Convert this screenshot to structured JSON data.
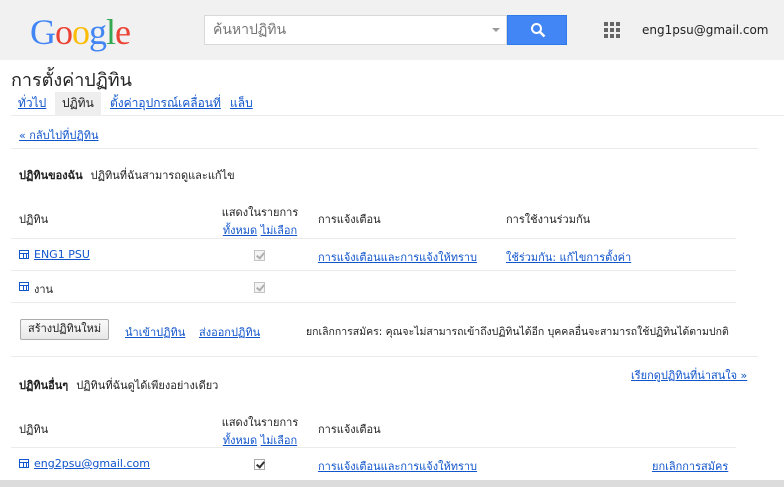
{
  "header": {
    "logo": [
      "G",
      "o",
      "o",
      "g",
      "l",
      "e"
    ],
    "search_placeholder": "ค้นหาปฏิทิน",
    "account": "eng1psu@gmail.com"
  },
  "page": {
    "title": "การตั้งค่าปฏิทิน",
    "tabs": [
      "ทั่วไป",
      "ปฏิทิน",
      "ตั้งค่าอุปกรณ์เคลื่อนที่",
      "แล็บ"
    ],
    "active_tab": "ปฏิทิน",
    "back_link": "« กลับไปที่ปฏิทิน"
  },
  "my_calendars": {
    "heading": "ปฏิทินของฉัน",
    "subheading": "ปฏิทินที่ฉันสามารถดูและแก้ไข",
    "columns": {
      "calendar": "ปฏิทิน",
      "show_in_list": "แสดงในรายการ",
      "all": "ทั้งหมด",
      "none": "ไม่เลือก",
      "notifications": "การแจ้งเตือน",
      "sharing": "การใช้งานร่วมกัน"
    },
    "rows": [
      {
        "name": "ENG1 PSU",
        "link": true,
        "checked": true,
        "notify": "การแจ้งเตือนและการแจ้งให้ทราบ",
        "share": "ใช้ร่วมกัน: แก้ไขการตั้งค่า"
      },
      {
        "name": "งาน",
        "link": false,
        "checked": true,
        "notify": "",
        "share": ""
      }
    ],
    "create_button": "สร้างปฏิทินใหม่",
    "import_link": "นำเข้าปฏิทิน",
    "export_link": "ส่งออกปฏิทิน",
    "unsubscribe_note": "ยกเลิกการสมัคร: คุณจะไม่สามารถเข้าถึงปฏิทินได้อีก บุคคลอื่นจะสามารถใช้ปฏิทินได้ตามปกติ"
  },
  "other_calendars": {
    "heading": "ปฏิทินอื่นๆ",
    "subheading": "ปฏิทินที่ฉันดูได้เพียงอย่างเดียว",
    "browse_link": "เรียกดูปฏิทินที่น่าสนใจ »",
    "columns": {
      "calendar": "ปฏิทิน",
      "show_in_list": "แสดงในรายการ",
      "all": "ทั้งหมด",
      "none": "ไม่เลือก",
      "notifications": "การแจ้งเตือน"
    },
    "rows": [
      {
        "name": "eng2psu@gmail.com",
        "checked": true,
        "notify": "การแจ้งเตือนและการแจ้งให้ทราบ",
        "unsubscribe": "ยกเลิกการสมัคร"
      }
    ]
  }
}
